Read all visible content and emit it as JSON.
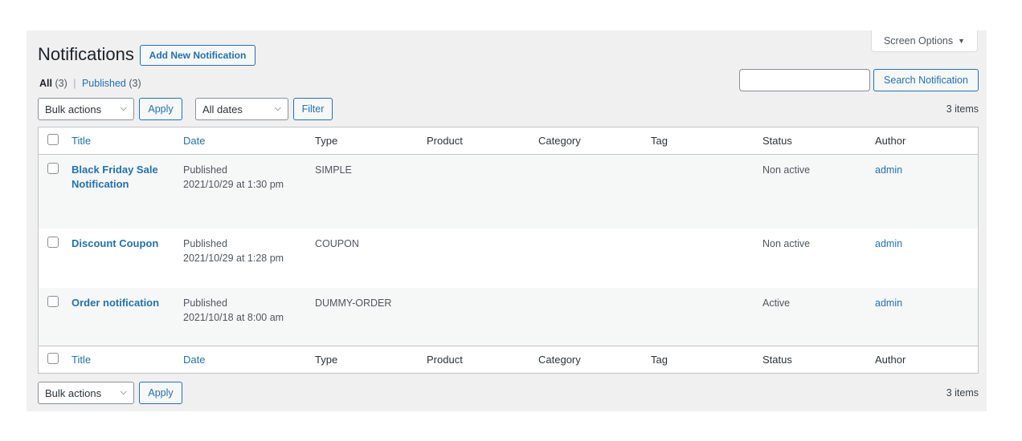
{
  "screen_options": "Screen Options",
  "page_title": "Notifications",
  "add_new": "Add New Notification",
  "views": {
    "all": "All",
    "all_count": "(3)",
    "sep": "|",
    "published": "Published",
    "published_count": "(3)"
  },
  "search": {
    "value": "",
    "placeholder": "",
    "button": "Search Notification"
  },
  "bulk": {
    "selected": "Bulk actions",
    "apply": "Apply"
  },
  "dates": {
    "selected": "All dates",
    "filter": "Filter"
  },
  "items_count": "3 items",
  "columns": [
    "Title",
    "Date",
    "Type",
    "Product",
    "Category",
    "Tag",
    "Status",
    "Author"
  ],
  "rows": [
    {
      "title": "Black Friday Sale Notification",
      "date_status": "Published",
      "date": "2021/10/29 at 1:30 pm",
      "type": "SIMPLE",
      "product": "",
      "category": "",
      "tag": "",
      "status": "Non active",
      "author": "admin"
    },
    {
      "title": "Discount Coupon",
      "date_status": "Published",
      "date": "2021/10/29 at 1:28 pm",
      "type": "COUPON",
      "product": "",
      "category": "",
      "tag": "",
      "status": "Non active",
      "author": "admin"
    },
    {
      "title": "Order notification",
      "date_status": "Published",
      "date": "2021/10/18 at 8:00 am",
      "type": "DUMMY-ORDER",
      "product": "",
      "category": "",
      "tag": "",
      "status": "Active",
      "author": "admin"
    }
  ],
  "colors": {
    "link": "#2271b1",
    "background": "#f0f0f1"
  }
}
